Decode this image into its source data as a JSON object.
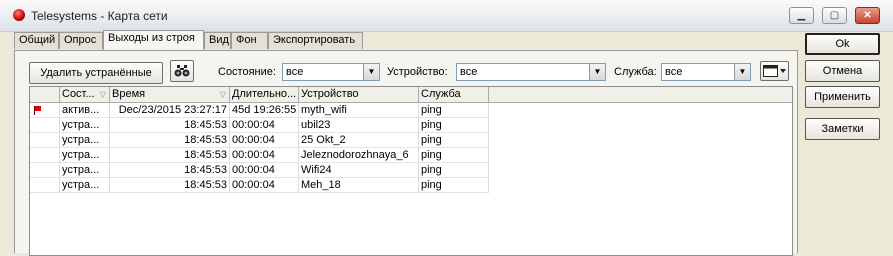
{
  "window": {
    "title": "Telesystems - Карта сети",
    "minimize": "▁",
    "restore": "▢",
    "close": "✕"
  },
  "tabs": [
    "Общий",
    "Опрос",
    "Выходы из строя",
    "Вид",
    "Фон",
    "Экспортировать"
  ],
  "active_tab": "Выходы из строя",
  "toolbar": {
    "remove_button": "Удалить устранённые",
    "binoculars_icon": "binoculars-icon",
    "state_label": "Состояние:",
    "state_value": "все",
    "device_label": "Устройство:",
    "device_value": "все",
    "service_label": "Служба:",
    "service_value": "все",
    "columns_icon": "columns-icon"
  },
  "grid": {
    "columns": [
      "Сост...",
      "Время",
      "Длительно...",
      "Устройство",
      "Служба"
    ],
    "rows": [
      {
        "state": "актив...",
        "time": "Dec/23/2015 23:27:17",
        "duration": "45d 19:26:55",
        "device": "myth_wifi",
        "service": "ping",
        "flag": true
      },
      {
        "state": "устра...",
        "time": "18:45:53",
        "duration": "00:00:04",
        "device": "ubil23",
        "service": "ping",
        "flag": false
      },
      {
        "state": "устра...",
        "time": "18:45:53",
        "duration": "00:00:04",
        "device": "25 Okt_2",
        "service": "ping",
        "flag": false
      },
      {
        "state": "устра...",
        "time": "18:45:53",
        "duration": "00:00:04",
        "device": "Jeleznodorozhnaya_6",
        "service": "ping",
        "flag": false
      },
      {
        "state": "устра...",
        "time": "18:45:53",
        "duration": "00:00:04",
        "device": "Wifi24",
        "service": "ping",
        "flag": false
      },
      {
        "state": "устра...",
        "time": "18:45:53",
        "duration": "00:00:04",
        "device": "Meh_18",
        "service": "ping",
        "flag": false
      }
    ]
  },
  "side_buttons": {
    "ok": "Ok",
    "cancel": "Отмена",
    "apply": "Применить",
    "notes": "Заметки"
  },
  "colors": {
    "flag": "#e00000",
    "background": "#ece9d8"
  }
}
